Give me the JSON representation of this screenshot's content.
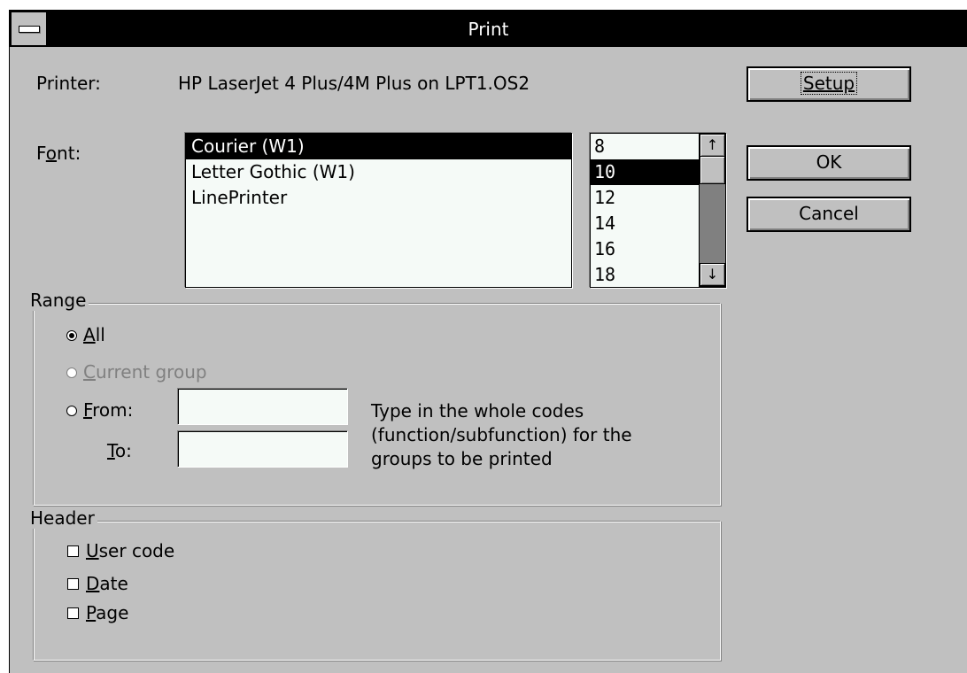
{
  "window": {
    "title": "Print"
  },
  "printer": {
    "label": "Printer:",
    "value": "HP LaserJet 4 Plus/4M Plus on LPT1.OS2"
  },
  "font": {
    "label_pre": "F",
    "label_accel": "o",
    "label_post": "nt:",
    "items": [
      "Courier (W1)",
      "Letter Gothic (W1)",
      "LinePrinter"
    ],
    "selected": "Courier (W1)"
  },
  "sizes": {
    "items": [
      "8",
      "10",
      "12",
      "14",
      "16",
      "18"
    ],
    "selected": "10",
    "scroll_up_icon": "arrow-up-icon",
    "scroll_down_icon": "arrow-down-icon"
  },
  "buttons": {
    "setup": "Setup",
    "ok": "OK",
    "cancel": "Cancel"
  },
  "range": {
    "title": "Range",
    "all_accel": "A",
    "all_rest": "ll",
    "current_accel": "C",
    "current_rest": "urrent group",
    "from_accel": "F",
    "from_rest": "rom:",
    "to_accel": "T",
    "to_rest": "o:",
    "selected": "All",
    "from_value": "",
    "to_value": "",
    "hint_lines": [
      "Type in the whole codes",
      "(function/subfunction) for the",
      "groups to be printed"
    ]
  },
  "header": {
    "title": "Header",
    "user_code_accel": "U",
    "user_code_rest": "ser code",
    "date_accel": "D",
    "date_rest": "ate",
    "page_accel": "P",
    "page_rest": "age",
    "user_code_checked": false,
    "date_checked": false,
    "page_checked": false
  },
  "colors": {
    "titlebar": "#000000",
    "dialog_bg": "#c0c0c0",
    "list_bg": "#f5faf7",
    "selection": "#000000",
    "disabled": "#808080"
  }
}
